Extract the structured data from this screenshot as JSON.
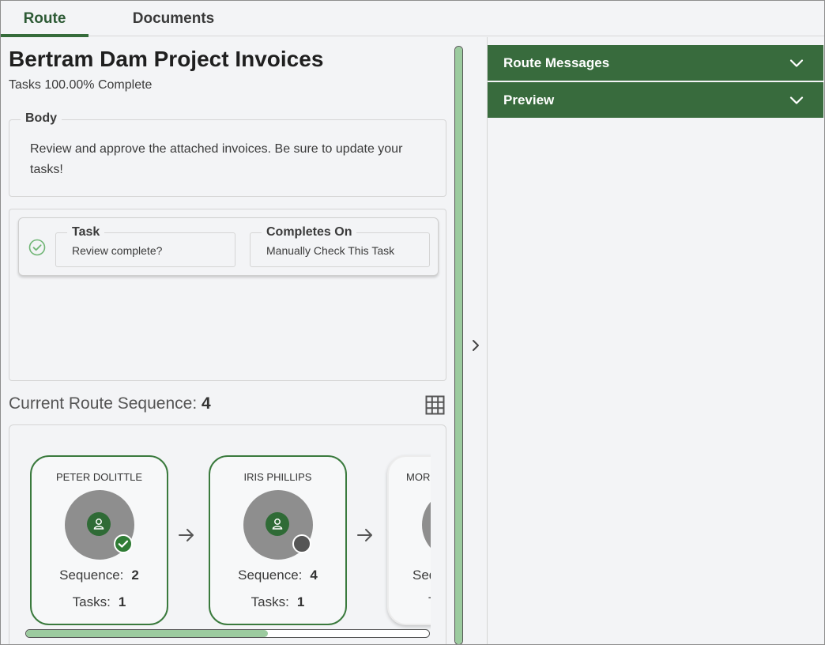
{
  "tabs": [
    {
      "label": "Route",
      "active": true
    },
    {
      "label": "Documents",
      "active": false
    }
  ],
  "route": {
    "title": "Bertram Dam Project Invoices",
    "progress_text": "Tasks 100.00% Complete",
    "body": {
      "legend": "Body",
      "text": "Review and approve the attached invoices. Be sure to update your tasks!"
    },
    "task": {
      "status_icon": "check-circle-icon",
      "task_label": "Task",
      "task_value": "Review complete?",
      "completes_label": "Completes On",
      "completes_value": "Manually Check This Task"
    },
    "sequence": {
      "label": "Current Route Sequence:",
      "value": "4"
    },
    "nodes": [
      {
        "name": "PETER DOLITTLE",
        "sequence_label": "Sequence:",
        "sequence": "2",
        "tasks_label": "Tasks:",
        "tasks": "1",
        "status": "complete"
      },
      {
        "name": "IRIS PHILLIPS",
        "sequence_label": "Sequence:",
        "sequence": "4",
        "tasks_label": "Tasks:",
        "tasks": "1",
        "status": "pending"
      },
      {
        "name": "MOR",
        "sequence_label": "Seq",
        "sequence": "",
        "tasks_label": "T",
        "tasks": "",
        "status": "unknown"
      }
    ],
    "horizontal_scroll_fraction": 0.6,
    "vertical_scroll_fraction": 1.0
  },
  "panels": {
    "route_messages": "Route Messages",
    "preview": "Preview"
  },
  "colors": {
    "accent": "#386b3d",
    "node_border": "#3a7a3d",
    "scroll_thumb": "#9ccb9f",
    "background": "#f3f4f6"
  }
}
